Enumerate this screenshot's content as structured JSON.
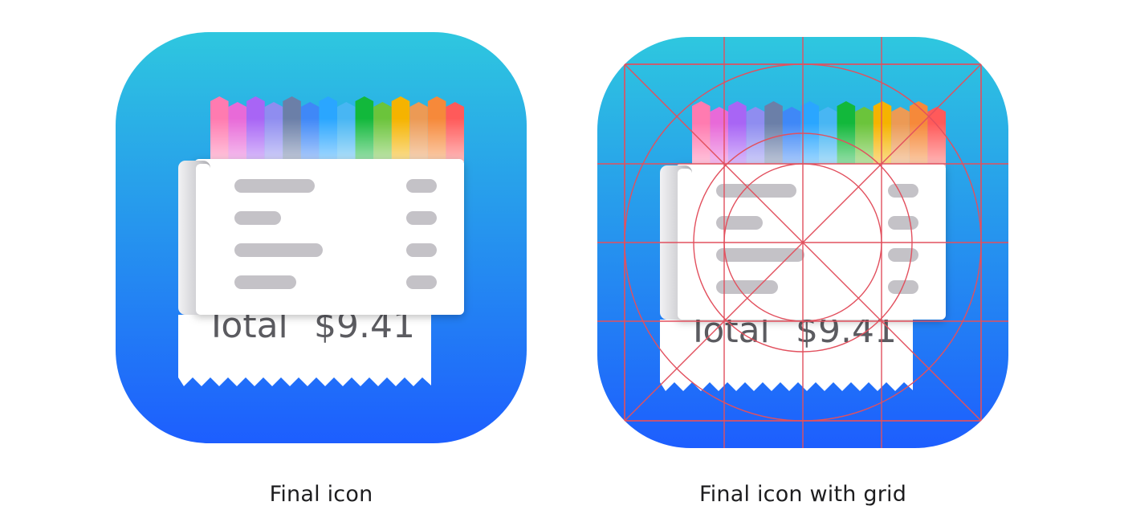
{
  "icons": [
    {
      "caption": "Final icon",
      "receipt": {
        "label": "Total",
        "amount": "$9.41"
      },
      "grid_overlay": false
    },
    {
      "caption": "Final icon with grid",
      "receipt": {
        "label": "Total",
        "amount": "$9.41"
      },
      "grid_overlay": true
    }
  ],
  "colors": {
    "background_top": "#2ec7df",
    "background_bottom": "#1d5efe",
    "grid_line": "#e2505e",
    "placeholder_bar": "#c4c2c7",
    "stripes": [
      "#ff7bb0",
      "#e86ad8",
      "#a865f5",
      "#8f8df0",
      "#6b7fa8",
      "#3f88f7",
      "#2aa6ff",
      "#48b6f3",
      "#12b83b",
      "#6bc43b",
      "#f5b300",
      "#ec9a55",
      "#f6893a",
      "#ff5a5a"
    ]
  },
  "icon_names": [
    "receipt-icon",
    "paper-roll-icon"
  ]
}
